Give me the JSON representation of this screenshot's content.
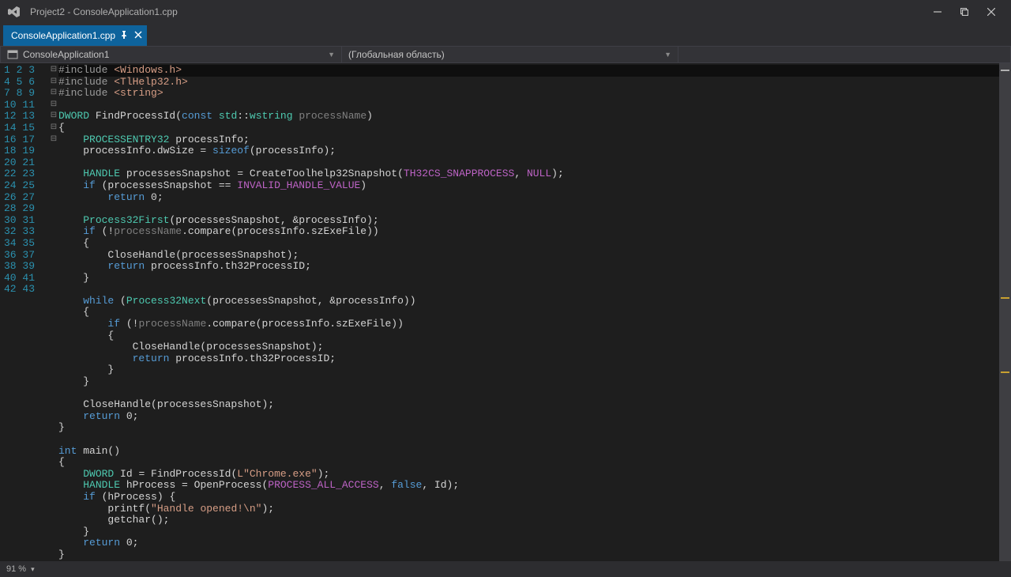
{
  "title": "Project2 - ConsoleApplication1.cpp",
  "tab": {
    "label": "ConsoleApplication1.cpp"
  },
  "nav": {
    "scope1": "ConsoleApplication1",
    "scope2": "(Глобальная область)"
  },
  "status": {
    "zoom": "91 %"
  },
  "code": {
    "lines": [
      {
        "n": 1,
        "fold": "⊟",
        "hl": true,
        "seg": [
          [
            "pp",
            "#include "
          ],
          [
            "str",
            "<Windows.h>"
          ]
        ]
      },
      {
        "n": 2,
        "seg": [
          [
            "pp",
            "#include "
          ],
          [
            "str",
            "<TlHelp32.h>"
          ]
        ]
      },
      {
        "n": 3,
        "seg": [
          [
            "pp",
            "#include "
          ],
          [
            "str",
            "<string>"
          ]
        ]
      },
      {
        "n": 4,
        "seg": []
      },
      {
        "n": 5,
        "fold": "⊟",
        "seg": [
          [
            "typ",
            "DWORD"
          ],
          [
            "",
            " FindProcessId("
          ],
          [
            "kw",
            "const"
          ],
          [
            "",
            " "
          ],
          [
            "typ",
            "std"
          ],
          [
            "",
            "::"
          ],
          [
            "typ",
            "wstring"
          ],
          [
            "",
            " "
          ],
          [
            "dim",
            "processName"
          ],
          [
            "",
            ")"
          ]
        ]
      },
      {
        "n": 6,
        "seg": [
          [
            "",
            "{"
          ]
        ]
      },
      {
        "n": 7,
        "seg": [
          [
            "",
            "    "
          ],
          [
            "typ",
            "PROCESSENTRY32"
          ],
          [
            "",
            " processInfo;"
          ]
        ]
      },
      {
        "n": 8,
        "seg": [
          [
            "",
            "    processInfo.dwSize = "
          ],
          [
            "kw",
            "sizeof"
          ],
          [
            "",
            "(processInfo);"
          ]
        ]
      },
      {
        "n": 9,
        "seg": []
      },
      {
        "n": 10,
        "seg": [
          [
            "",
            "    "
          ],
          [
            "typ",
            "HANDLE"
          ],
          [
            "",
            " processesSnapshot = CreateToolhelp32Snapshot("
          ],
          [
            "mac",
            "TH32CS_SNAPPROCESS"
          ],
          [
            "",
            ", "
          ],
          [
            "mac",
            "NULL"
          ],
          [
            "",
            ");"
          ]
        ]
      },
      {
        "n": 11,
        "seg": [
          [
            "",
            "    "
          ],
          [
            "kw",
            "if"
          ],
          [
            "",
            " (processesSnapshot == "
          ],
          [
            "mac",
            "INVALID_HANDLE_VALUE"
          ],
          [
            "",
            ")"
          ]
        ]
      },
      {
        "n": 12,
        "seg": [
          [
            "",
            "        "
          ],
          [
            "kw",
            "return"
          ],
          [
            "",
            " 0;"
          ]
        ]
      },
      {
        "n": 13,
        "seg": []
      },
      {
        "n": 14,
        "seg": [
          [
            "",
            "    "
          ],
          [
            "typ",
            "Process32First"
          ],
          [
            "",
            "(processesSnapshot, &processInfo);"
          ]
        ]
      },
      {
        "n": 15,
        "fold": "⊟",
        "seg": [
          [
            "",
            "    "
          ],
          [
            "kw",
            "if"
          ],
          [
            "",
            " (!"
          ],
          [
            "dim",
            "processName"
          ],
          [
            "",
            ".compare(processInfo.szExeFile))"
          ]
        ]
      },
      {
        "n": 16,
        "seg": [
          [
            "",
            "    {"
          ]
        ]
      },
      {
        "n": 17,
        "seg": [
          [
            "",
            "        CloseHandle(processesSnapshot);"
          ]
        ]
      },
      {
        "n": 18,
        "seg": [
          [
            "",
            "        "
          ],
          [
            "kw",
            "return"
          ],
          [
            "",
            " processInfo.th32ProcessID;"
          ]
        ]
      },
      {
        "n": 19,
        "seg": [
          [
            "",
            "    }"
          ]
        ]
      },
      {
        "n": 20,
        "seg": []
      },
      {
        "n": 21,
        "fold": "⊟",
        "seg": [
          [
            "",
            "    "
          ],
          [
            "kw",
            "while"
          ],
          [
            "",
            " ("
          ],
          [
            "typ",
            "Process32Next"
          ],
          [
            "",
            "(processesSnapshot, &processInfo))"
          ]
        ]
      },
      {
        "n": 22,
        "seg": [
          [
            "",
            "    {"
          ]
        ]
      },
      {
        "n": 23,
        "fold": "⊟",
        "mark": true,
        "seg": [
          [
            "",
            "        "
          ],
          [
            "kw",
            "if"
          ],
          [
            "",
            " (!"
          ],
          [
            "dim",
            "processName"
          ],
          [
            "",
            ".compare(processInfo.szExeFile))"
          ]
        ]
      },
      {
        "n": 24,
        "seg": [
          [
            "",
            "        {"
          ]
        ]
      },
      {
        "n": 25,
        "seg": [
          [
            "",
            "            CloseHandle(processesSnapshot);"
          ]
        ]
      },
      {
        "n": 26,
        "seg": [
          [
            "",
            "            "
          ],
          [
            "kw",
            "return"
          ],
          [
            "",
            " processInfo.th32ProcessID;"
          ]
        ]
      },
      {
        "n": 27,
        "seg": [
          [
            "",
            "        }"
          ]
        ]
      },
      {
        "n": 28,
        "seg": [
          [
            "",
            "    }"
          ]
        ]
      },
      {
        "n": 29,
        "seg": []
      },
      {
        "n": 30,
        "mark": true,
        "seg": [
          [
            "",
            "    CloseHandle(processesSnapshot);"
          ]
        ]
      },
      {
        "n": 31,
        "seg": [
          [
            "",
            "    "
          ],
          [
            "kw",
            "return"
          ],
          [
            "",
            " 0;"
          ]
        ]
      },
      {
        "n": 32,
        "seg": [
          [
            "",
            "}"
          ]
        ]
      },
      {
        "n": 33,
        "seg": []
      },
      {
        "n": 34,
        "fold": "⊟",
        "seg": [
          [
            "kw",
            "int"
          ],
          [
            "",
            " main()"
          ]
        ]
      },
      {
        "n": 35,
        "seg": [
          [
            "",
            "{"
          ]
        ]
      },
      {
        "n": 36,
        "seg": [
          [
            "",
            "    "
          ],
          [
            "typ",
            "DWORD"
          ],
          [
            "",
            " Id = FindProcessId("
          ],
          [
            "str",
            "L\"Chrome.exe\""
          ],
          [
            "",
            ");"
          ]
        ]
      },
      {
        "n": 37,
        "seg": [
          [
            "",
            "    "
          ],
          [
            "typ",
            "HANDLE"
          ],
          [
            "",
            " hProcess = OpenProcess("
          ],
          [
            "mac",
            "PROCESS_ALL_ACCESS"
          ],
          [
            "",
            ", "
          ],
          [
            "kw",
            "false"
          ],
          [
            "",
            ", Id);"
          ]
        ]
      },
      {
        "n": 38,
        "fold": "⊟",
        "seg": [
          [
            "",
            "    "
          ],
          [
            "kw",
            "if"
          ],
          [
            "",
            " (hProcess) {"
          ]
        ]
      },
      {
        "n": 39,
        "seg": [
          [
            "",
            "        printf("
          ],
          [
            "str",
            "\"Handle opened!\\n\""
          ],
          [
            "",
            ");"
          ]
        ]
      },
      {
        "n": 40,
        "seg": [
          [
            "",
            "        getchar();"
          ]
        ]
      },
      {
        "n": 41,
        "seg": [
          [
            "",
            "    }"
          ]
        ]
      },
      {
        "n": 42,
        "seg": [
          [
            "",
            "    "
          ],
          [
            "kw",
            "return"
          ],
          [
            "",
            " 0;"
          ]
        ]
      },
      {
        "n": 43,
        "seg": [
          [
            "",
            "}"
          ]
        ]
      }
    ]
  }
}
